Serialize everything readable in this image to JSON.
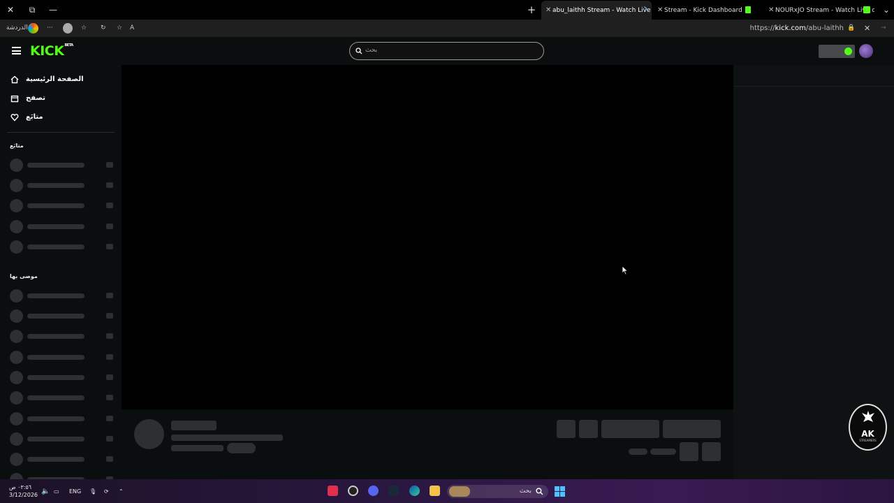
{
  "browser": {
    "tabs": [
      {
        "title": "abu_laithh Stream - Watch Live on",
        "active": true
      },
      {
        "title": "Stream - Kick Dashboard",
        "active": false
      },
      {
        "title": "NOURxJO Stream - Watch Live on",
        "active": false
      }
    ],
    "profile_label": "الدردشة",
    "url_prefix": "https://",
    "url_domain": "kick.com",
    "url_path": "/abu-laithh",
    "accent": "#53fc18"
  },
  "kick": {
    "logo": "KICK",
    "logo_badge": "BETA",
    "search_placeholder": "بحث",
    "nav": [
      {
        "label": "الصفحة الرئيسية",
        "icon": "home-icon"
      },
      {
        "label": "تصفح",
        "icon": "browse-icon"
      },
      {
        "label": "متابَع",
        "icon": "heart-icon"
      }
    ],
    "section_following": "متابَع",
    "section_recommended": "موصى بها"
  },
  "overlay": {
    "emblem_title": "AK",
    "emblem_sub": "STREAMERS"
  },
  "taskbar": {
    "time": "٠٣:٥٦ ص",
    "date": "3/12/2026",
    "lang": "ENG",
    "search_placeholder": "بحث"
  }
}
